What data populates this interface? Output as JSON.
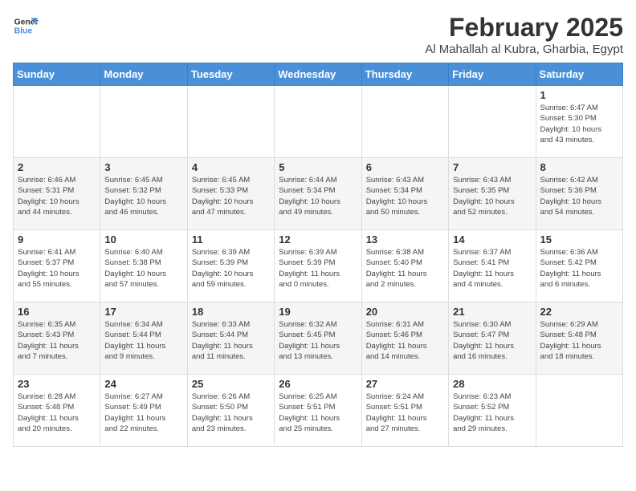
{
  "logo": {
    "line1": "General",
    "line2": "Blue"
  },
  "title": {
    "month_year": "February 2025",
    "location": "Al Mahallah al Kubra, Gharbia, Egypt"
  },
  "weekdays": [
    "Sunday",
    "Monday",
    "Tuesday",
    "Wednesday",
    "Thursday",
    "Friday",
    "Saturday"
  ],
  "weeks": [
    [
      {
        "day": "",
        "info": ""
      },
      {
        "day": "",
        "info": ""
      },
      {
        "day": "",
        "info": ""
      },
      {
        "day": "",
        "info": ""
      },
      {
        "day": "",
        "info": ""
      },
      {
        "day": "",
        "info": ""
      },
      {
        "day": "1",
        "info": "Sunrise: 6:47 AM\nSunset: 5:30 PM\nDaylight: 10 hours\nand 43 minutes."
      }
    ],
    [
      {
        "day": "2",
        "info": "Sunrise: 6:46 AM\nSunset: 5:31 PM\nDaylight: 10 hours\nand 44 minutes."
      },
      {
        "day": "3",
        "info": "Sunrise: 6:45 AM\nSunset: 5:32 PM\nDaylight: 10 hours\nand 46 minutes."
      },
      {
        "day": "4",
        "info": "Sunrise: 6:45 AM\nSunset: 5:33 PM\nDaylight: 10 hours\nand 47 minutes."
      },
      {
        "day": "5",
        "info": "Sunrise: 6:44 AM\nSunset: 5:34 PM\nDaylight: 10 hours\nand 49 minutes."
      },
      {
        "day": "6",
        "info": "Sunrise: 6:43 AM\nSunset: 5:34 PM\nDaylight: 10 hours\nand 50 minutes."
      },
      {
        "day": "7",
        "info": "Sunrise: 6:43 AM\nSunset: 5:35 PM\nDaylight: 10 hours\nand 52 minutes."
      },
      {
        "day": "8",
        "info": "Sunrise: 6:42 AM\nSunset: 5:36 PM\nDaylight: 10 hours\nand 54 minutes."
      }
    ],
    [
      {
        "day": "9",
        "info": "Sunrise: 6:41 AM\nSunset: 5:37 PM\nDaylight: 10 hours\nand 55 minutes."
      },
      {
        "day": "10",
        "info": "Sunrise: 6:40 AM\nSunset: 5:38 PM\nDaylight: 10 hours\nand 57 minutes."
      },
      {
        "day": "11",
        "info": "Sunrise: 6:39 AM\nSunset: 5:39 PM\nDaylight: 10 hours\nand 59 minutes."
      },
      {
        "day": "12",
        "info": "Sunrise: 6:39 AM\nSunset: 5:39 PM\nDaylight: 11 hours\nand 0 minutes."
      },
      {
        "day": "13",
        "info": "Sunrise: 6:38 AM\nSunset: 5:40 PM\nDaylight: 11 hours\nand 2 minutes."
      },
      {
        "day": "14",
        "info": "Sunrise: 6:37 AM\nSunset: 5:41 PM\nDaylight: 11 hours\nand 4 minutes."
      },
      {
        "day": "15",
        "info": "Sunrise: 6:36 AM\nSunset: 5:42 PM\nDaylight: 11 hours\nand 6 minutes."
      }
    ],
    [
      {
        "day": "16",
        "info": "Sunrise: 6:35 AM\nSunset: 5:43 PM\nDaylight: 11 hours\nand 7 minutes."
      },
      {
        "day": "17",
        "info": "Sunrise: 6:34 AM\nSunset: 5:44 PM\nDaylight: 11 hours\nand 9 minutes."
      },
      {
        "day": "18",
        "info": "Sunrise: 6:33 AM\nSunset: 5:44 PM\nDaylight: 11 hours\nand 11 minutes."
      },
      {
        "day": "19",
        "info": "Sunrise: 6:32 AM\nSunset: 5:45 PM\nDaylight: 11 hours\nand 13 minutes."
      },
      {
        "day": "20",
        "info": "Sunrise: 6:31 AM\nSunset: 5:46 PM\nDaylight: 11 hours\nand 14 minutes."
      },
      {
        "day": "21",
        "info": "Sunrise: 6:30 AM\nSunset: 5:47 PM\nDaylight: 11 hours\nand 16 minutes."
      },
      {
        "day": "22",
        "info": "Sunrise: 6:29 AM\nSunset: 5:48 PM\nDaylight: 11 hours\nand 18 minutes."
      }
    ],
    [
      {
        "day": "23",
        "info": "Sunrise: 6:28 AM\nSunset: 5:48 PM\nDaylight: 11 hours\nand 20 minutes."
      },
      {
        "day": "24",
        "info": "Sunrise: 6:27 AM\nSunset: 5:49 PM\nDaylight: 11 hours\nand 22 minutes."
      },
      {
        "day": "25",
        "info": "Sunrise: 6:26 AM\nSunset: 5:50 PM\nDaylight: 11 hours\nand 23 minutes."
      },
      {
        "day": "26",
        "info": "Sunrise: 6:25 AM\nSunset: 5:51 PM\nDaylight: 11 hours\nand 25 minutes."
      },
      {
        "day": "27",
        "info": "Sunrise: 6:24 AM\nSunset: 5:51 PM\nDaylight: 11 hours\nand 27 minutes."
      },
      {
        "day": "28",
        "info": "Sunrise: 6:23 AM\nSunset: 5:52 PM\nDaylight: 11 hours\nand 29 minutes."
      },
      {
        "day": "",
        "info": ""
      }
    ]
  ]
}
